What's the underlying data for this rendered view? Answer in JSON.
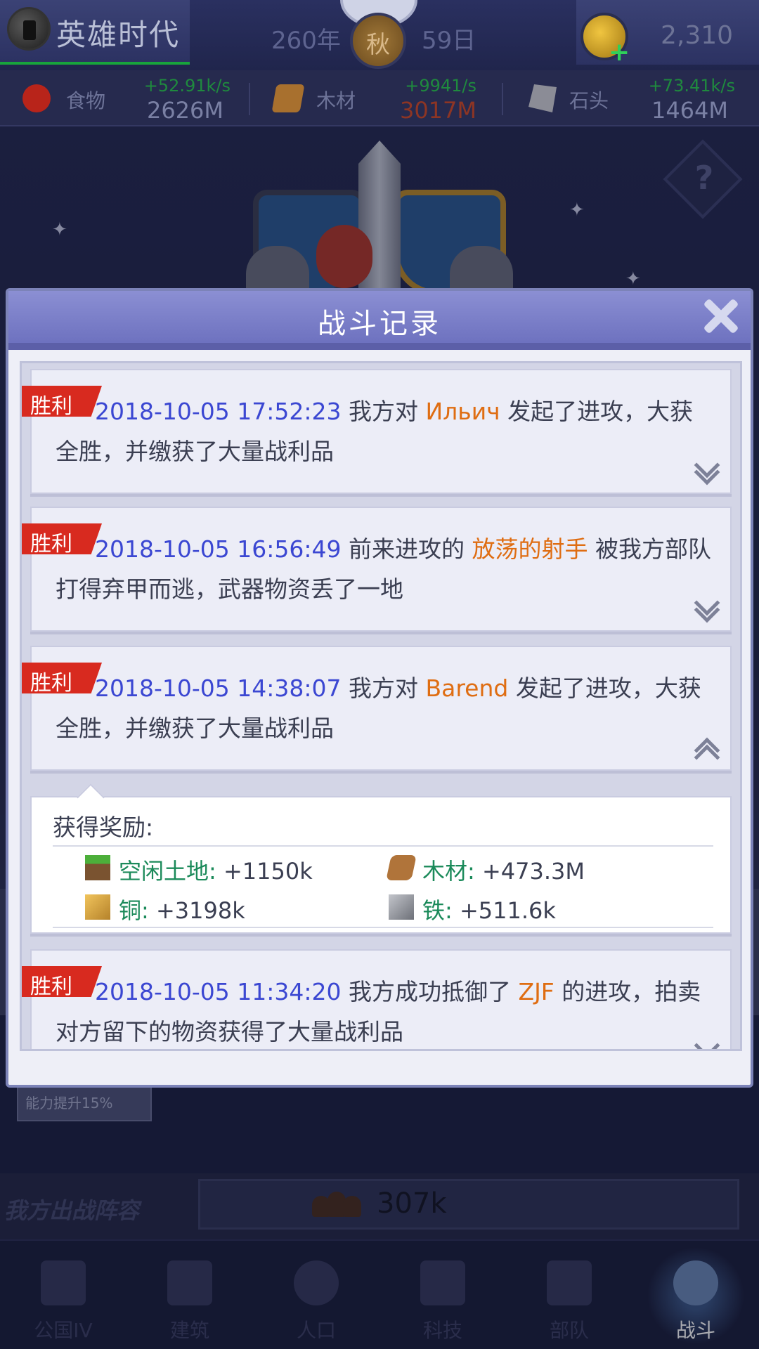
{
  "header": {
    "title": "英雄时代",
    "year": "260年",
    "season": "秋",
    "day": "59日",
    "gold": "2,310"
  },
  "resources": [
    {
      "name": "食物",
      "rate": "+52.91k/s",
      "amount": "2626M",
      "icon": "food-apple-icon"
    },
    {
      "name": "木材",
      "rate": "+9941/s",
      "amount": "3017M",
      "icon": "wood-logs-icon",
      "amount_color": "#8d3524"
    },
    {
      "name": "石头",
      "rate": "+73.41k/s",
      "amount": "1464M",
      "icon": "stone-icon"
    }
  ],
  "background": {
    "buff_text": "能力提升15%",
    "lineup_label": "我方出战阵容",
    "lineup_power": "307k"
  },
  "dialog": {
    "title": "战斗记录",
    "records": [
      {
        "badge": "胜利",
        "time": "2018-10-05 17:52:23",
        "pre": " 我方对 ",
        "who": "Ильич",
        "post": " 发起了进攻，大获全胜，并缴获了大量战利品",
        "expand": "down"
      },
      {
        "badge": "胜利",
        "time": "2018-10-05 16:56:49",
        "pre": " 前来进攻的 ",
        "who": "放荡的射手",
        "post": " 被我方部队打得弃甲而逃，武器物资丢了一地",
        "expand": "down"
      },
      {
        "badge": "胜利",
        "time": "2018-10-05 14:38:07",
        "pre": " 我方对 ",
        "who": "Barend",
        "post": " 发起了进攻，大获全胜，并缴获了大量战利品",
        "expand": "up"
      },
      {
        "badge": "胜利",
        "time": "2018-10-05 11:34:20",
        "pre": " 我方成功抵御了 ",
        "who": "ZJF",
        "post": " 的进攻，拍卖对方留下的物资获得了大量战利品",
        "expand": "down"
      }
    ],
    "reward": {
      "title": "获得奖励:",
      "items": [
        {
          "key": "空闲土地:",
          "value": " +1150k",
          "icon": "grass-block-icon"
        },
        {
          "key": "木材:",
          "value": " +473.3M",
          "icon": "wood-logs-icon"
        },
        {
          "key": "铜:",
          "value": " +3198k",
          "icon": "copper-block-icon"
        },
        {
          "key": "铁:",
          "value": " +511.6k",
          "icon": "iron-block-icon"
        }
      ]
    }
  },
  "nav": [
    {
      "label": "公国IV",
      "icon": "castle-icon"
    },
    {
      "label": "建筑",
      "icon": "house-icon"
    },
    {
      "label": "人口",
      "icon": "person-icon"
    },
    {
      "label": "科技",
      "icon": "book-icon"
    },
    {
      "label": "部队",
      "icon": "banner-icon"
    },
    {
      "label": "战斗",
      "icon": "crossed-swords-icon",
      "active": true
    }
  ],
  "colors": {
    "accent_time": "#3b47d2",
    "accent_name": "#df6d12",
    "victory_badge": "#d82a1f",
    "resource_rate": "#1f8a3e",
    "reward_key": "#1b8a5a"
  }
}
